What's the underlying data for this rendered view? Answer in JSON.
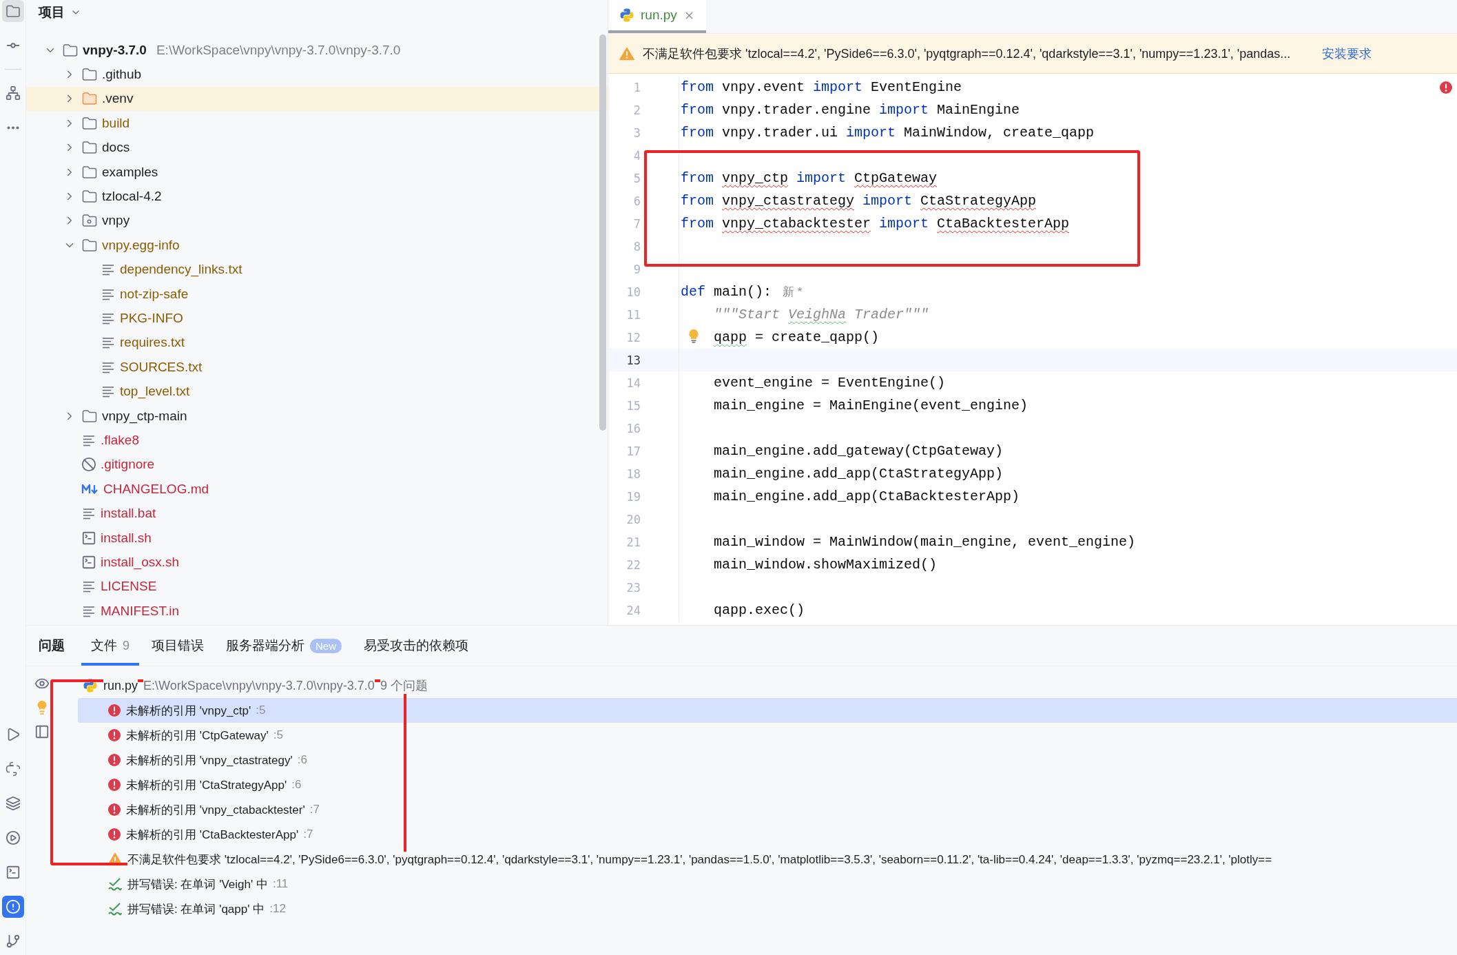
{
  "tool_strip": {
    "top": [
      {
        "selected": true
      },
      {
        "selected": false
      },
      {
        "selected": false
      },
      {
        "selected": false
      }
    ],
    "bottom": [
      {
        "selected": false
      },
      {
        "selected": false
      },
      {
        "selected": false
      },
      {
        "selected": false
      },
      {
        "selected": false
      },
      {
        "selected": true
      },
      {
        "selected": false
      }
    ]
  },
  "project_panel": {
    "title": "项目",
    "tree": [
      {
        "name": "vnpy-3.7.0",
        "path": "E:\\WorkSpace\\vnpy\\vnpy-3.7.0\\vnpy-3.7.0",
        "kind": "folder",
        "color": "#1e1f22",
        "excluded": false,
        "expanded": true,
        "children": [
          {
            "name": ".github",
            "kind": "folder",
            "color": "#1e1f22",
            "excluded": false,
            "expanded": false
          },
          {
            "name": ".venv",
            "kind": "folder",
            "color": "#1e1f22",
            "excluded": true,
            "expanded": false
          },
          {
            "name": "build",
            "kind": "folder",
            "color": "#8c5b00",
            "excluded": false,
            "expanded": false
          },
          {
            "name": "docs",
            "kind": "folder",
            "color": "#1e1f22",
            "excluded": false,
            "expanded": false
          },
          {
            "name": "examples",
            "kind": "folder",
            "color": "#1e1f22",
            "excluded": false,
            "expanded": false
          },
          {
            "name": "tzlocal-4.2",
            "kind": "folder",
            "color": "#1e1f22",
            "excluded": false,
            "expanded": false
          },
          {
            "name": "vnpy",
            "kind": "package",
            "color": "#1e1f22",
            "excluded": false,
            "expanded": false
          },
          {
            "name": "vnpy.egg-info",
            "kind": "folder",
            "color": "#8c5b00",
            "excluded": false,
            "expanded": true,
            "children": [
              {
                "name": "dependency_links.txt",
                "kind": "text",
                "color": "#8c5b00",
                "excluded": false
              },
              {
                "name": "not-zip-safe",
                "kind": "text",
                "color": "#8c5b00",
                "excluded": false
              },
              {
                "name": "PKG-INFO",
                "kind": "text",
                "color": "#8c5b00",
                "excluded": false
              },
              {
                "name": "requires.txt",
                "kind": "text",
                "color": "#8c5b00",
                "excluded": false
              },
              {
                "name": "SOURCES.txt",
                "kind": "text",
                "color": "#8c5b00",
                "excluded": false
              },
              {
                "name": "top_level.txt",
                "kind": "text",
                "color": "#8c5b00",
                "excluded": false
              }
            ]
          },
          {
            "name": "vnpy_ctp-main",
            "kind": "folder",
            "color": "#1e1f22",
            "excluded": false,
            "expanded": false
          },
          {
            "name": ".flake8",
            "kind": "text",
            "color": "#c3273c",
            "excluded": false
          },
          {
            "name": ".gitignore",
            "kind": "ignore",
            "color": "#c3273c",
            "excluded": false
          },
          {
            "name": "CHANGELOG.md",
            "kind": "markdown",
            "color": "#c3273c",
            "excluded": false
          },
          {
            "name": "install.bat",
            "kind": "text",
            "color": "#c3273c",
            "excluded": false
          },
          {
            "name": "install.sh",
            "kind": "script",
            "color": "#c3273c",
            "excluded": false
          },
          {
            "name": "install_osx.sh",
            "kind": "script",
            "color": "#c3273c",
            "excluded": false
          },
          {
            "name": "LICENSE",
            "kind": "text",
            "color": "#c3273c",
            "excluded": false
          },
          {
            "name": "MANIFEST.in",
            "kind": "text",
            "color": "#c3273c",
            "excluded": false
          }
        ]
      }
    ]
  },
  "editor": {
    "tab": {
      "label": "run.py",
      "selected": true,
      "color": "#3f8f3a"
    },
    "banner": {
      "message": "不满足软件包要求 'tzlocal==4.2', 'PySide6==6.3.0', 'pyqtgraph==0.12.4', 'qdarkstyle==3.1', 'numpy==1.23.1', 'pandas...",
      "action": "安装要求"
    },
    "has_errors": true,
    "lines": [
      {
        "number": "1",
        "indented": false,
        "current": false,
        "bulb": false,
        "tokens": [
          {
            "text": "from",
            "kind": "kw"
          },
          {
            "text": " vnpy.event ",
            "kind": "id"
          },
          {
            "text": "import",
            "kind": "kw"
          },
          {
            "text": " EventEngine",
            "kind": "id"
          }
        ]
      },
      {
        "number": "2",
        "indented": false,
        "current": false,
        "bulb": false,
        "tokens": [
          {
            "text": "from",
            "kind": "kw"
          },
          {
            "text": " vnpy.trader.engine ",
            "kind": "id"
          },
          {
            "text": "import",
            "kind": "kw"
          },
          {
            "text": " MainEngine",
            "kind": "id"
          }
        ]
      },
      {
        "number": "3",
        "indented": false,
        "current": false,
        "bulb": false,
        "tokens": [
          {
            "text": "from",
            "kind": "kw"
          },
          {
            "text": " vnpy.trader.ui ",
            "kind": "id"
          },
          {
            "text": "import",
            "kind": "kw"
          },
          {
            "text": " MainWindow, create_qapp",
            "kind": "id"
          }
        ]
      },
      {
        "number": "4",
        "current": false,
        "bulb": false
      },
      {
        "number": "5",
        "indented": false,
        "current": false,
        "bulb": false,
        "tokens": [
          {
            "text": "from ",
            "kind": "kw"
          },
          {
            "text": "vnpy_ctp",
            "kind": "err"
          },
          {
            "text": " import ",
            "kind": "kw"
          },
          {
            "text": "CtpGateway",
            "kind": "err"
          }
        ]
      },
      {
        "number": "6",
        "indented": false,
        "current": false,
        "bulb": false,
        "tokens": [
          {
            "text": "from ",
            "kind": "kw"
          },
          {
            "text": "vnpy_ctastrategy",
            "kind": "err"
          },
          {
            "text": " import ",
            "kind": "kw"
          },
          {
            "text": "CtaStrategyApp",
            "kind": "err"
          }
        ]
      },
      {
        "number": "7",
        "indented": false,
        "current": false,
        "bulb": false,
        "tokens": [
          {
            "text": "from ",
            "kind": "kw"
          },
          {
            "text": "vnpy_ctabacktester",
            "kind": "err"
          },
          {
            "text": " import ",
            "kind": "kw"
          },
          {
            "text": "CtaBacktesterApp",
            "kind": "err"
          }
        ]
      },
      {
        "number": "8",
        "current": false,
        "bulb": false
      },
      {
        "number": "9",
        "current": false,
        "bulb": false
      },
      {
        "number": "10",
        "indented": false,
        "current": false,
        "bulb": false,
        "hint": "新 *",
        "tokens": [
          {
            "text": "def",
            "kind": "kw"
          },
          {
            "text": " main():",
            "kind": "id"
          }
        ]
      },
      {
        "number": "11",
        "indented": true,
        "current": false,
        "bulb": false,
        "tokens": [
          {
            "text": "\"\"\"Start ",
            "kind": "doc"
          },
          {
            "text": "VeighNa",
            "kind": "doctypo"
          },
          {
            "text": " Trader\"\"\"",
            "kind": "doc"
          }
        ]
      },
      {
        "number": "12",
        "indented": true,
        "current": false,
        "bulb": true,
        "tokens": [
          {
            "text": "qapp",
            "kind": "typo"
          },
          {
            "text": " = create_qapp()",
            "kind": "id"
          }
        ]
      },
      {
        "number": "13",
        "current": true,
        "bulb": false
      },
      {
        "number": "14",
        "indented": true,
        "current": false,
        "bulb": false,
        "tokens": [
          {
            "text": "event_engine = EventEngine()",
            "kind": "id"
          }
        ]
      },
      {
        "number": "15",
        "indented": true,
        "current": false,
        "bulb": false,
        "tokens": [
          {
            "text": "main_engine = MainEngine(event_engine)",
            "kind": "id"
          }
        ]
      },
      {
        "number": "16",
        "current": false,
        "bulb": false
      },
      {
        "number": "17",
        "indented": true,
        "current": false,
        "bulb": false,
        "tokens": [
          {
            "text": "main_engine.add_gateway(CtpGateway)",
            "kind": "id"
          }
        ]
      },
      {
        "number": "18",
        "indented": true,
        "current": false,
        "bulb": false,
        "tokens": [
          {
            "text": "main_engine.add_app(CtaStrategyApp)",
            "kind": "id"
          }
        ]
      },
      {
        "number": "19",
        "indented": true,
        "current": false,
        "bulb": false,
        "tokens": [
          {
            "text": "main_engine.add_app(CtaBacktesterApp)",
            "kind": "id"
          }
        ]
      },
      {
        "number": "20",
        "current": false,
        "bulb": false
      },
      {
        "number": "21",
        "indented": true,
        "current": false,
        "bulb": false,
        "tokens": [
          {
            "text": "main_window = MainWindow(main_engine, event_engine)",
            "kind": "id"
          }
        ]
      },
      {
        "number": "22",
        "indented": true,
        "current": false,
        "bulb": false,
        "tokens": [
          {
            "text": "main_window.showMaximized()",
            "kind": "id"
          }
        ]
      },
      {
        "number": "23",
        "current": false,
        "bulb": false
      },
      {
        "number": "24",
        "indented": true,
        "current": false,
        "bulb": false,
        "tokens": [
          {
            "text": "qapp.exec()",
            "kind": "id"
          }
        ]
      }
    ]
  },
  "problems_panel": {
    "title": "问题",
    "tabs": [
      {
        "label": "文件",
        "count": "9",
        "selected": true
      },
      {
        "label": "项目错误",
        "selected": false
      },
      {
        "label": "服务器端分析",
        "badge": "New",
        "selected": false
      },
      {
        "label": "易受攻击的依赖项",
        "selected": false
      }
    ],
    "file": {
      "name": "run.py",
      "path": "E:\\WorkSpace\\vnpy\\vnpy-3.7.0\\vnpy-3.7.0",
      "summary": "9 个问题"
    },
    "items": [
      {
        "kind": "error",
        "text": "未解析的引用 'vnpy_ctp'",
        "location": ":5",
        "selected": true
      },
      {
        "kind": "error",
        "text": "未解析的引用 'CtpGateway'",
        "location": ":5",
        "selected": false
      },
      {
        "kind": "error",
        "text": "未解析的引用 'vnpy_ctastrategy'",
        "location": ":6",
        "selected": false
      },
      {
        "kind": "error",
        "text": "未解析的引用 'CtaStrategyApp'",
        "location": ":6",
        "selected": false
      },
      {
        "kind": "error",
        "text": "未解析的引用 'vnpy_ctabacktester'",
        "location": ":7",
        "selected": false
      },
      {
        "kind": "error",
        "text": "未解析的引用 'CtaBacktesterApp'",
        "location": ":7",
        "selected": false
      },
      {
        "kind": "warning",
        "text": "不满足软件包要求 'tzlocal==4.2', 'PySide6==6.3.0', 'pyqtgraph==0.12.4', 'qdarkstyle==3.1', 'numpy==1.23.1', 'pandas==1.5.0', 'matplotlib==3.5.3', 'seaborn==0.11.2', 'ta-lib==0.4.24', 'deap==1.3.3', 'pyzmq==23.2.1', 'plotly==",
        "selected": false
      },
      {
        "kind": "typo",
        "text": "拼写错误: 在单词 'Veigh' 中",
        "location": ":11",
        "selected": false
      },
      {
        "kind": "typo",
        "text": "拼写错误: 在单词 'qapp' 中",
        "location": ":12",
        "selected": false
      }
    ]
  }
}
